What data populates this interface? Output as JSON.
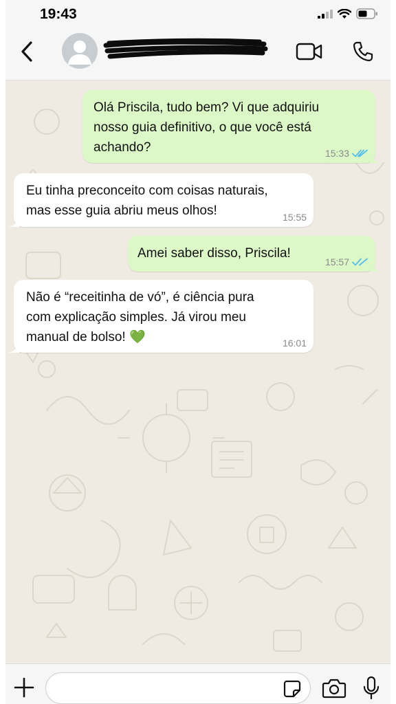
{
  "status_bar": {
    "time": "19:43",
    "icons": [
      "signal-icon",
      "wifi-icon",
      "battery-icon"
    ]
  },
  "header": {
    "back_icon": "chevron-left-icon",
    "avatar_icon": "default-avatar-icon",
    "contact_name": "",
    "contact_name_redacted": true,
    "video_call_icon": "video-camera-icon",
    "voice_call_icon": "phone-icon"
  },
  "messages": [
    {
      "direction": "outgoing",
      "text": "Olá Priscila, tudo bem? Vi que adquiriu\nnosso guia definitivo, o que você está\nachando?",
      "time": "15:33",
      "read": true
    },
    {
      "direction": "incoming",
      "text": "Eu tinha preconceito com coisas naturais,\nmas esse guia abriu meus olhos!",
      "time": "15:55"
    },
    {
      "direction": "outgoing",
      "text": "Amei saber disso, Priscila!",
      "time": "15:57",
      "read": true
    },
    {
      "direction": "incoming",
      "text": "Não é “receitinha de vó”, é ciência pura\ncom explicação simples. Já virou meu\nmanual de bolso!",
      "emoji": "💚",
      "time": "16:01"
    }
  ],
  "composer": {
    "value": "",
    "placeholder": "",
    "plus_icon": "plus-icon",
    "sticker_icon": "sticker-icon",
    "camera_icon": "camera-icon",
    "mic_icon": "microphone-icon"
  },
  "colors": {
    "chat_background": "#efeae2",
    "outgoing_bubble": "#dcf8c6",
    "incoming_bubble": "#ffffff",
    "read_ticks": "#53bdeb",
    "bar_background": "#f6f6f6"
  }
}
